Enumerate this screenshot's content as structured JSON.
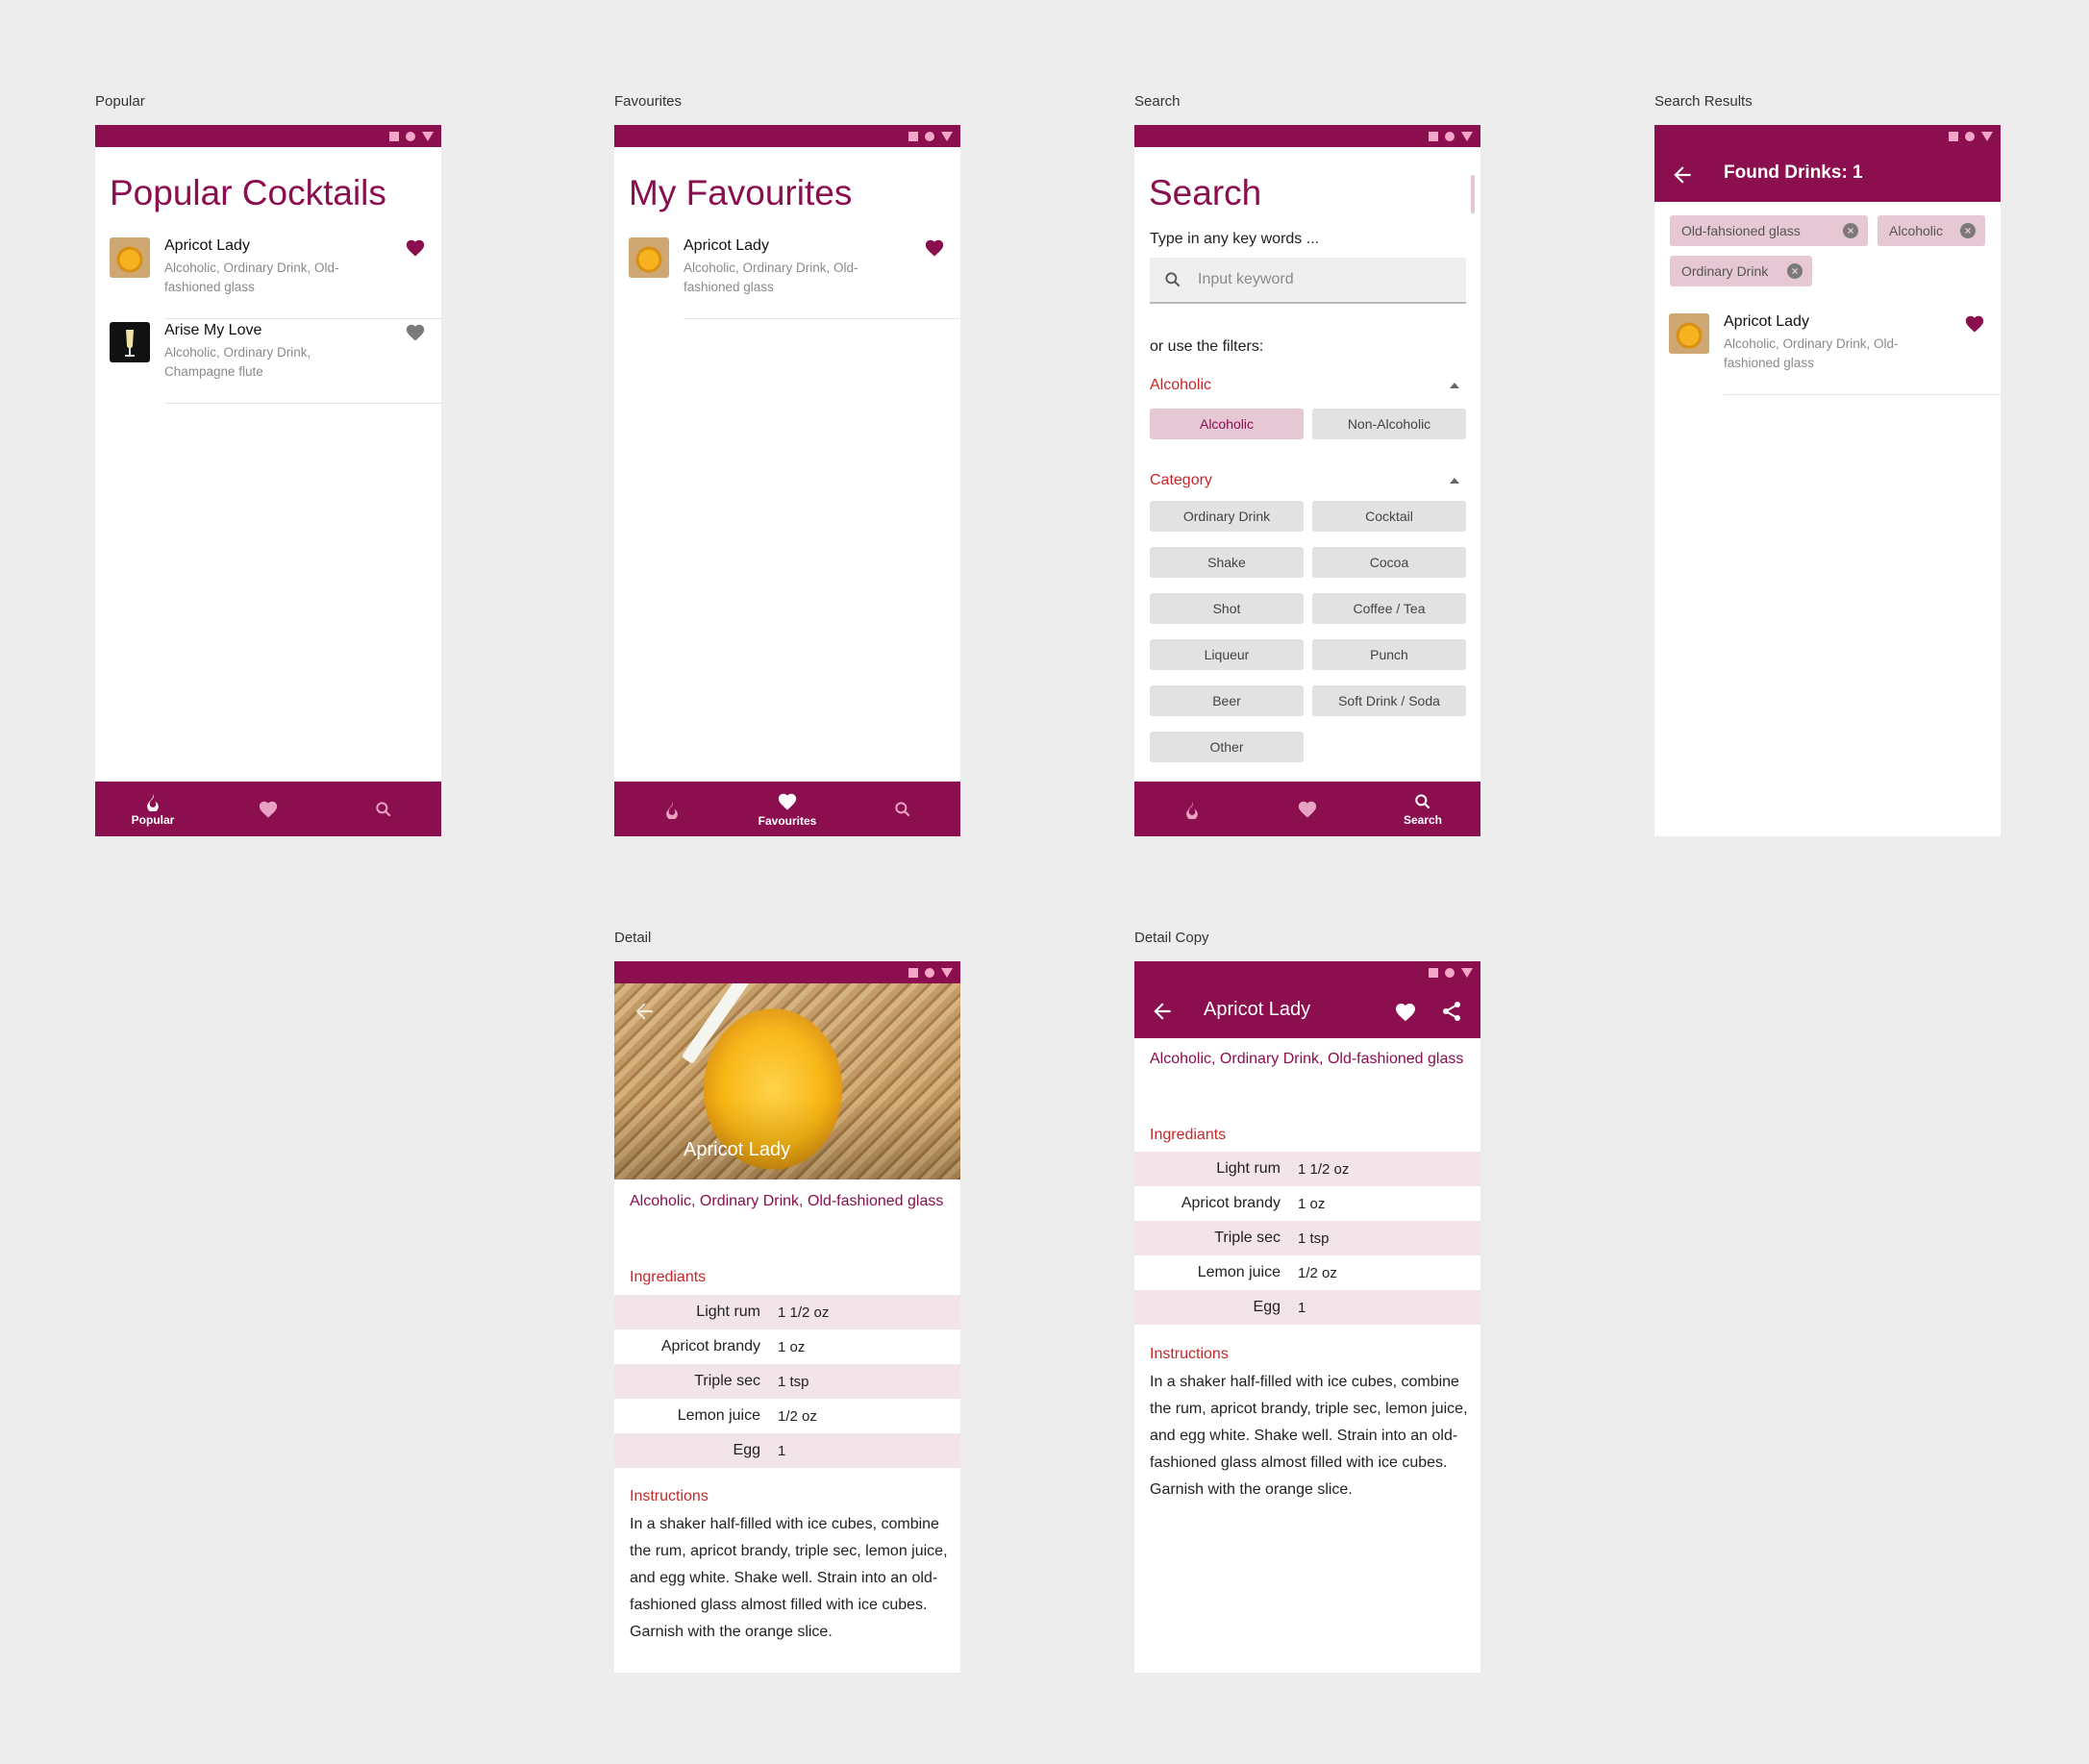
{
  "frames": {
    "popular": "Popular",
    "favourites": "Favourites",
    "search": "Search",
    "search_results": "Search Results",
    "detail": "Detail",
    "detail_copy": "Detail Copy"
  },
  "colors": {
    "primary": "#8b0e4e",
    "accent_red": "#c62828",
    "chip_selected": "#e6c8d5",
    "row_alt": "#f3e4ea"
  },
  "popular": {
    "title": "Popular Cocktails",
    "items": [
      {
        "title": "Apricot Lady",
        "subtitle": "Alcoholic, Ordinary Drink, Old-fashioned glass",
        "favourite": true
      },
      {
        "title": "Arise My Love",
        "subtitle": "Alcoholic, Ordinary Drink, Champagne flute",
        "favourite": false
      }
    ]
  },
  "favourites": {
    "title": "My Favourites",
    "items": [
      {
        "title": "Apricot Lady",
        "subtitle": "Alcoholic, Ordinary Drink, Old-fashioned glass",
        "favourite": true
      }
    ]
  },
  "nav": {
    "popular": "Popular",
    "favourites": "Favourites",
    "search": "Search"
  },
  "search": {
    "title": "Search",
    "hint": "Type in any key words ...",
    "placeholder": "Input keyword",
    "filters_hint": "or use the filters:",
    "alcoholic_head": "Alcoholic",
    "alcoholic_options": [
      "Alcoholic",
      "Non-Alcoholic"
    ],
    "category_head": "Category",
    "categories": [
      "Ordinary Drink",
      "Cocktail",
      "Shake",
      "Cocoa",
      "Shot",
      "Coffee / Tea",
      "Liqueur",
      "Punch",
      "Beer",
      "Soft Drink / Soda",
      "Other"
    ]
  },
  "results": {
    "title": "Found Drinks: 1",
    "filters": [
      "Old-fahsioned glass",
      "Alcoholic",
      "Ordinary Drink"
    ],
    "items": [
      {
        "title": "Apricot Lady",
        "subtitle": "Alcoholic, Ordinary Drink, Old-fashioned glass",
        "favourite": true
      }
    ]
  },
  "detail": {
    "name": "Apricot Lady",
    "tags": "Alcoholic, Ordinary Drink, Old-fashioned glass",
    "ingredients_head": "Ingrediants",
    "ingredients": [
      {
        "name": "Light rum",
        "measure": "1 1/2 oz"
      },
      {
        "name": "Apricot brandy",
        "measure": "1 oz"
      },
      {
        "name": "Triple sec",
        "measure": "1 tsp"
      },
      {
        "name": "Lemon juice",
        "measure": "1/2 oz"
      },
      {
        "name": "Egg",
        "measure": "1"
      }
    ],
    "instructions_head": "Instructions",
    "instructions": "In a shaker half-filled with ice cubes, combine the rum, apricot brandy, triple sec, lemon juice, and egg white. Shake well. Strain into an old-fashioned glass almost filled with ice cubes. Garnish with the orange slice."
  }
}
